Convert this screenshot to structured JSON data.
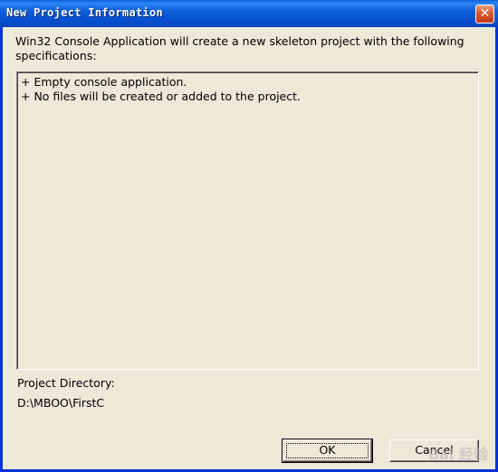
{
  "window": {
    "title": "New Project Information",
    "close_glyph": "✕"
  },
  "description": "Win32 Console Application will create a new skeleton project with the following specifications:",
  "specifications": [
    "+ Empty console application.",
    "+ No files will be created or added to the project."
  ],
  "project_directory": {
    "label": "Project Directory:",
    "value": "D:\\MBOO\\FirstC"
  },
  "buttons": {
    "ok_label": "OK",
    "cancel_label": "Cancel"
  },
  "watermark": "Bai 经验"
}
